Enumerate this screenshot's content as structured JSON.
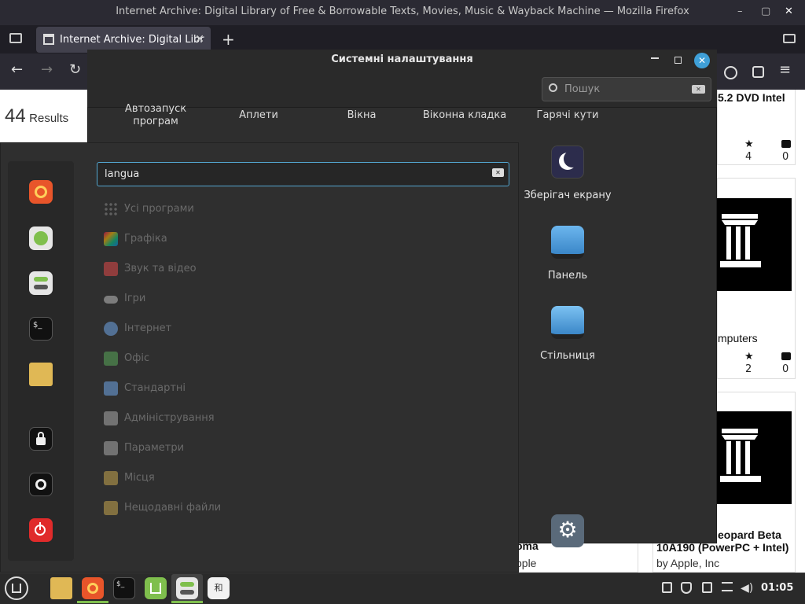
{
  "firefox": {
    "window_title": "Internet Archive: Digital Library of Free & Borrowable Texts, Movies, Music & Wayback Machine — Mozilla Firefox",
    "tab_title": "Internet Archive: Digital Libr",
    "new_tab": "+",
    "tab_close": "✕",
    "minimize": "–",
    "maximize": "▢",
    "close": "✕",
    "back": "←",
    "forward": "→",
    "reload": "↻",
    "menu": "≡"
  },
  "page": {
    "results_count": "44",
    "results_label": "Results",
    "card1_title": "5.2 DVD Intel",
    "card1_favs": "4",
    "card1_comments": "0",
    "card2_title": "mputers",
    "card2_favs": "2",
    "card2_comments": "0",
    "card3_title": "eopard Beta",
    "card3_subtitle": "10A190 (PowerPC + Intel)",
    "card3_by": "by Apple, Inc",
    "card4_title": "oma",
    "card4_by": "pple"
  },
  "settings": {
    "title": "Системні налаштування",
    "search_placeholder": "Пошук",
    "categories": [
      "Автозапуск програм",
      "Аплети",
      "Вікна",
      "Віконна кладка",
      "Гарячі кути"
    ],
    "tiles": [
      {
        "label": "Зберігач екрану",
        "icon": "moon-icon"
      },
      {
        "label": "Панель",
        "icon": "panel-icon"
      },
      {
        "label": "Стільниця",
        "icon": "desktop-icon"
      }
    ]
  },
  "menu": {
    "search_value": "langua",
    "categories": [
      {
        "label": "Усі програми",
        "icon": "grid-icon",
        "color": "#888888"
      },
      {
        "label": "Графіка",
        "icon": "graphics-icon",
        "color": "#b86ad6"
      },
      {
        "label": "Звук та відео",
        "icon": "media-icon",
        "color": "#e04848"
      },
      {
        "label": "Ігри",
        "icon": "gamepad-icon",
        "color": "#cccccc"
      },
      {
        "label": "Інтернет",
        "icon": "cloud-icon",
        "color": "#6fa6e8"
      },
      {
        "label": "Офіс",
        "icon": "office-icon",
        "color": "#5aa85a"
      },
      {
        "label": "Стандартні",
        "icon": "scissors-icon",
        "color": "#6fa6e8"
      },
      {
        "label": "Адміністрування",
        "icon": "admin-icon",
        "color": "#aaaaaa"
      },
      {
        "label": "Параметри",
        "icon": "settings-icon",
        "color": "#aaaaaa"
      },
      {
        "label": "Місця",
        "icon": "folder-icon",
        "color": "#c7a64e"
      },
      {
        "label": "Нещодавні файли",
        "icon": "recent-folder-icon",
        "color": "#c7a64e"
      }
    ]
  },
  "taskbar": {
    "clock": "01:05"
  },
  "colors": {
    "accent": "#53a6d0",
    "firefox_orange": "#e8552a",
    "mint_green": "#7fbf4d",
    "close_blue": "#3fa0d8",
    "power_red": "#e02b2b"
  }
}
